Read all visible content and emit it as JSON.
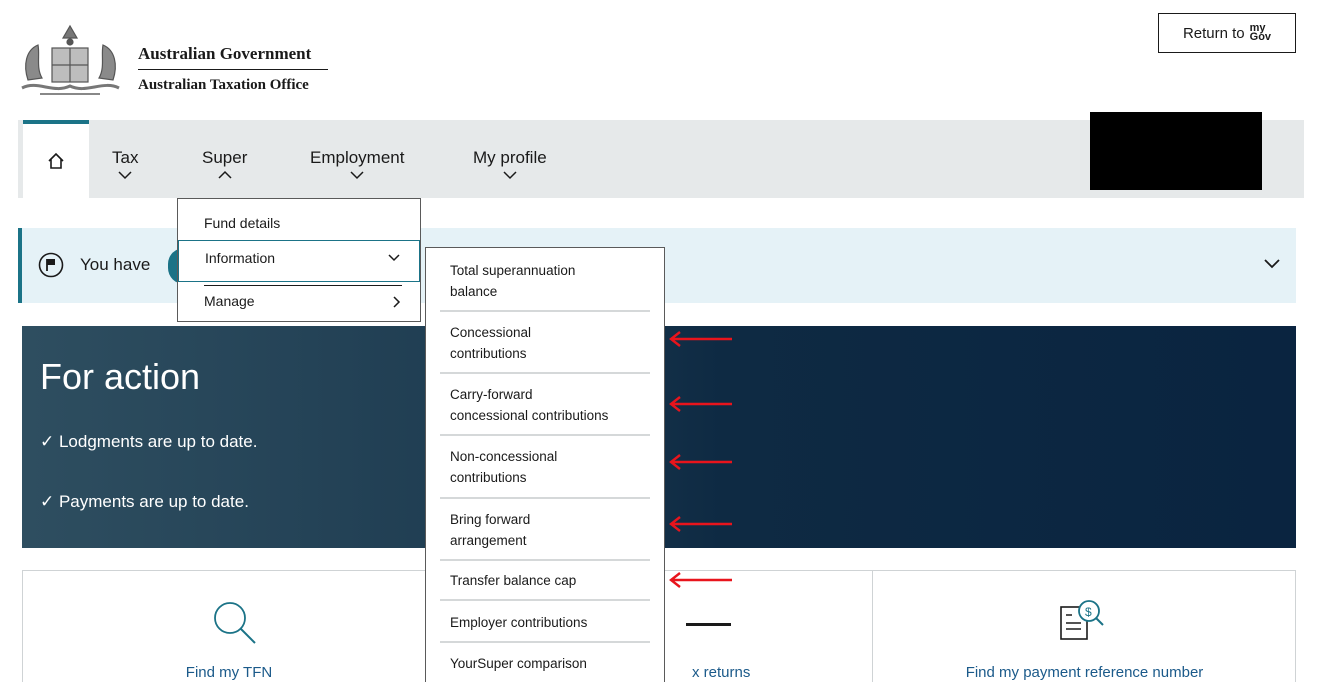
{
  "header": {
    "gov_line1": "Australian Government",
    "gov_line2": "Australian Taxation Office",
    "return_label": "Return to",
    "mygov_top": "my",
    "mygov_bottom": "Gov"
  },
  "nav": {
    "items": [
      {
        "label": "Tax"
      },
      {
        "label": "Super"
      },
      {
        "label": "Employment"
      },
      {
        "label": "My profile"
      }
    ]
  },
  "notice": {
    "text": "You have"
  },
  "super_menu": {
    "items": [
      {
        "label": "Fund details"
      },
      {
        "label": "Information"
      },
      {
        "label": "Manage"
      }
    ]
  },
  "info_menu": {
    "items": [
      {
        "line1": "Total superannuation",
        "line2": "balance"
      },
      {
        "line1": "Concessional",
        "line2": "contributions"
      },
      {
        "line1": "Carry-forward",
        "line2": "concessional contributions"
      },
      {
        "line1": "Non-concessional",
        "line2": "contributions"
      },
      {
        "line1": "Bring forward",
        "line2": "arrangement"
      },
      {
        "line1": "Transfer balance cap",
        "line2": ""
      },
      {
        "line1": "Employer contributions",
        "line2": ""
      },
      {
        "line1": "YourSuper comparison",
        "line2": ""
      }
    ]
  },
  "action": {
    "title": "For action",
    "line1": "Lodgments are up to date.",
    "line2": "Payments are up to date."
  },
  "cards": {
    "items": [
      {
        "label": "Find my TFN",
        "icon": "magnifier-icon"
      },
      {
        "label": "x returns",
        "icon": "returns-icon"
      },
      {
        "label": "Find my payment reference number",
        "icon": "payment-reference-icon"
      }
    ]
  },
  "colors": {
    "accent": "#1b7387",
    "banner": "#0a2440",
    "annotation": "#e8141c"
  }
}
